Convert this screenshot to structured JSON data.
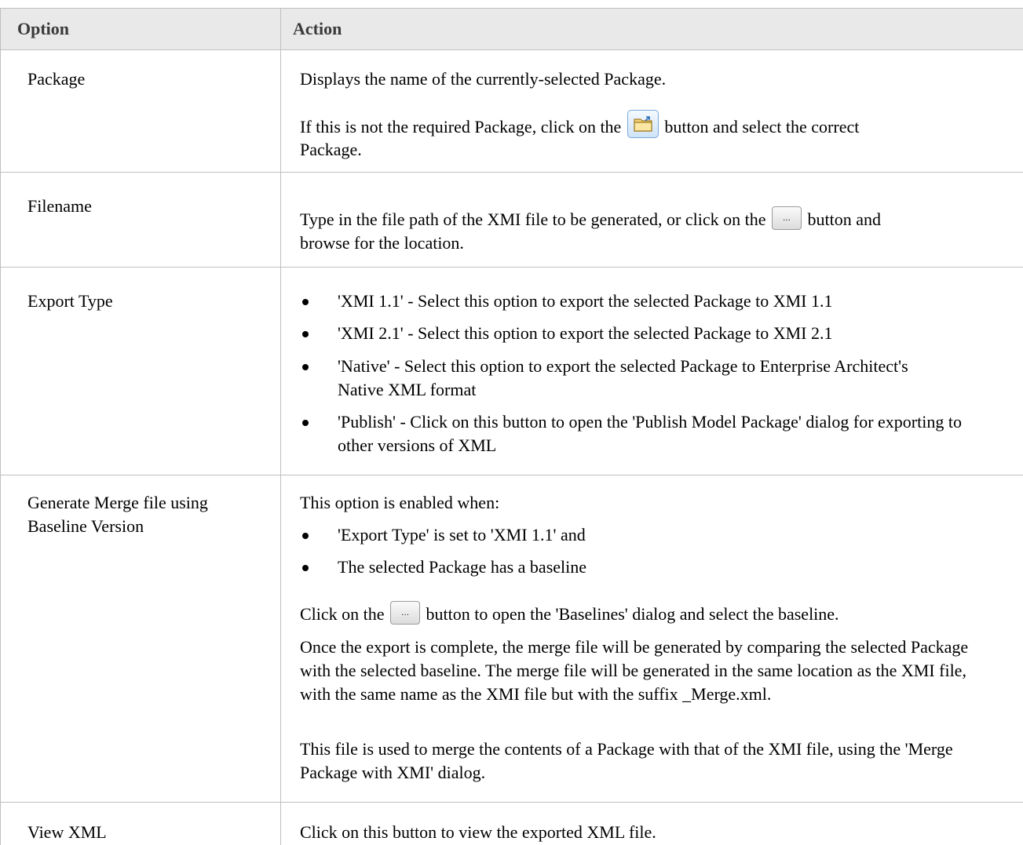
{
  "header": {
    "option": "Option",
    "action": "Action"
  },
  "rows": {
    "package": {
      "option": "Package",
      "line1": "Displays the name of the currently-selected Package.",
      "line2_pre": "If this is not the required Package, click on the",
      "line2_post": "button and select the correct",
      "line3": "Package."
    },
    "filename": {
      "option": "Filename",
      "line1_pre": "Type in the file path of the XMI file to be generated, or click on the",
      "line1_post": "button and",
      "line2": "browse for the location."
    },
    "export_type": {
      "option": "Export Type",
      "bullets": [
        "'XMI 1.1' - Select this option to export the selected Package to XMI 1.1",
        "'XMI 2.1' - Select this option to export the selected Package to XMI 2.1",
        "'Native' - Select this option to export the selected Package to Enterprise Architect's Native XML format",
        "'Publish' - Click on this button to open the 'Publish Model Package' dialog for exporting to other versions of XML"
      ]
    },
    "merge": {
      "option": "Generate Merge file using Baseline Version",
      "intro": "This option is enabled when:",
      "bullets": [
        "'Export Type' is set to 'XMI 1.1' and",
        "The selected Package has a baseline"
      ],
      "click_pre": "Click on the",
      "click_post": "button to open the 'Baselines' dialog and select the baseline.",
      "para1": "Once the export is complete, the merge file will be generated by comparing the selected Package with the selected baseline. The merge file will be generated in the same location as the XMI file, with the same name as the XMI file but with the suffix _Merge.xml.",
      "para2": "This file is used to merge the contents of a Package with that of the XMI file, using the 'Merge Package with XMI' dialog."
    },
    "view_xml": {
      "option": "View XML",
      "text": "Click on this button to view the exported XML file."
    }
  },
  "icons": {
    "folder_button": "folder-icon",
    "ellipsis_button": "ellipsis-icon",
    "ellipsis_text": "..."
  }
}
